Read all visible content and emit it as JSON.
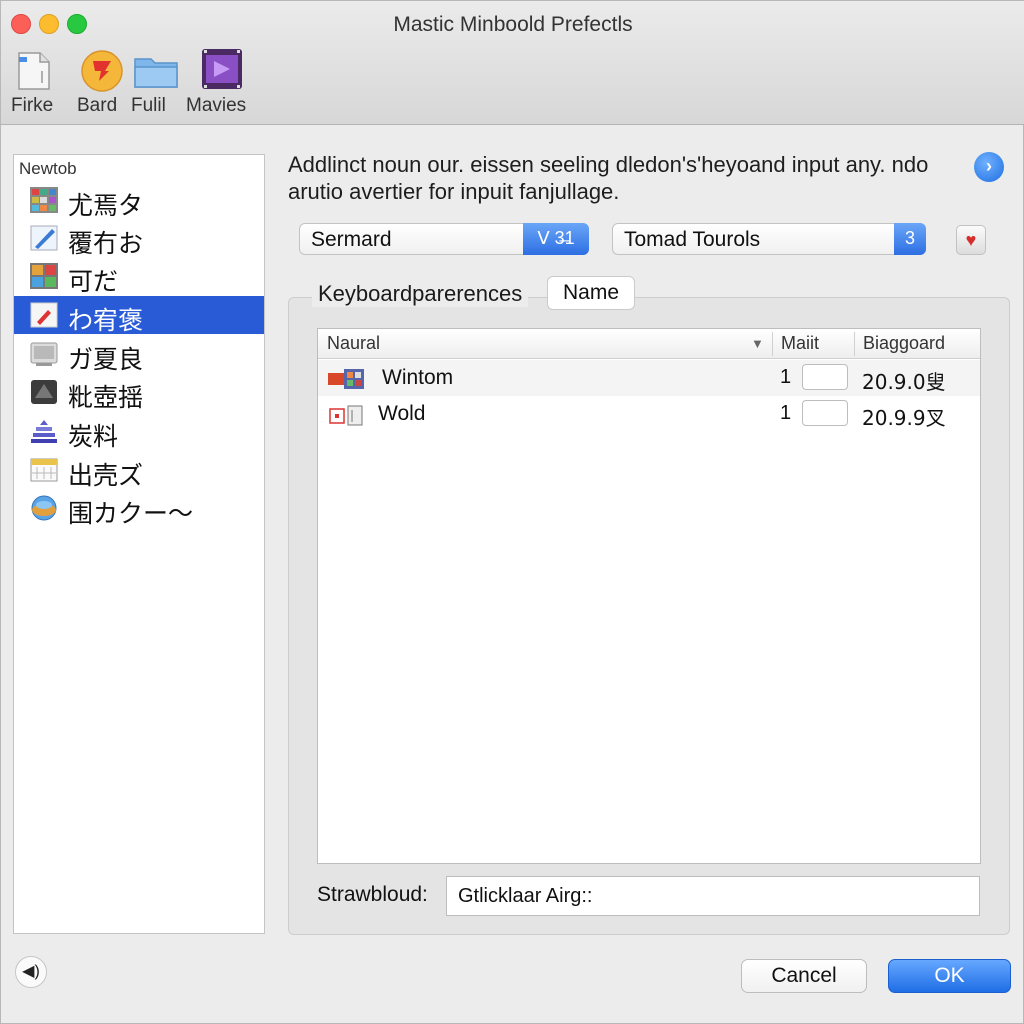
{
  "window": {
    "title": "Mastic Minboold Prefectls"
  },
  "toolbar": {
    "items": [
      {
        "label": "Firke",
        "icon": "file-icon"
      },
      {
        "label": "Bard",
        "icon": "bird-icon"
      },
      {
        "label": "Fulil",
        "icon": "folder-icon"
      },
      {
        "label": "Mavies",
        "icon": "movie-icon"
      }
    ]
  },
  "sidebar": {
    "header": "Newtob",
    "items": [
      {
        "label": "尤焉タ",
        "icon": "mosaic-icon",
        "selected": false
      },
      {
        "label": "覆冇お",
        "icon": "pen-icon",
        "selected": false
      },
      {
        "label": "可だ",
        "icon": "grid-icon",
        "selected": false
      },
      {
        "label": "わ宥褒",
        "icon": "edit-icon",
        "selected": true
      },
      {
        "label": "ガ夏良",
        "icon": "terminal-icon",
        "selected": false
      },
      {
        "label": "粃壺揺",
        "icon": "hat-icon",
        "selected": false
      },
      {
        "label": "炭料",
        "icon": "stack-icon",
        "selected": false
      },
      {
        "label": "出壳ズ",
        "icon": "calendar-icon",
        "selected": false
      },
      {
        "label": "围カクー〜",
        "icon": "globe-icon",
        "selected": false
      }
    ]
  },
  "main": {
    "description": "Addlinct noun our. eissen seeling dledon's'heyoand input any. ndo arutio avertier for inpuit fanjullage.",
    "popup_left": {
      "value": "Sermard",
      "badge": "ᐯ 3̶1"
    },
    "popup_right": {
      "value": "Tomad Tourols",
      "badge": "3"
    },
    "group_label": "Keyboardparerences",
    "tab_label": "Name"
  },
  "table": {
    "columns": [
      "Naural",
      "Maiit",
      "Biaggoard"
    ],
    "rows": [
      {
        "name": "Wintom",
        "count": "1",
        "version": "20.9.0叟"
      },
      {
        "name": "Wold",
        "count": "1",
        "version": "20.9.9叉"
      }
    ]
  },
  "path": {
    "label": "Strawbloud:",
    "value": "Gtlicklaar Airg::"
  },
  "buttons": {
    "cancel": "Cancel",
    "ok": "OK"
  },
  "colors": {
    "accent": "#2a5bd7",
    "ok_button": "#1f6ee6",
    "help_button": "#1f6fe0"
  }
}
